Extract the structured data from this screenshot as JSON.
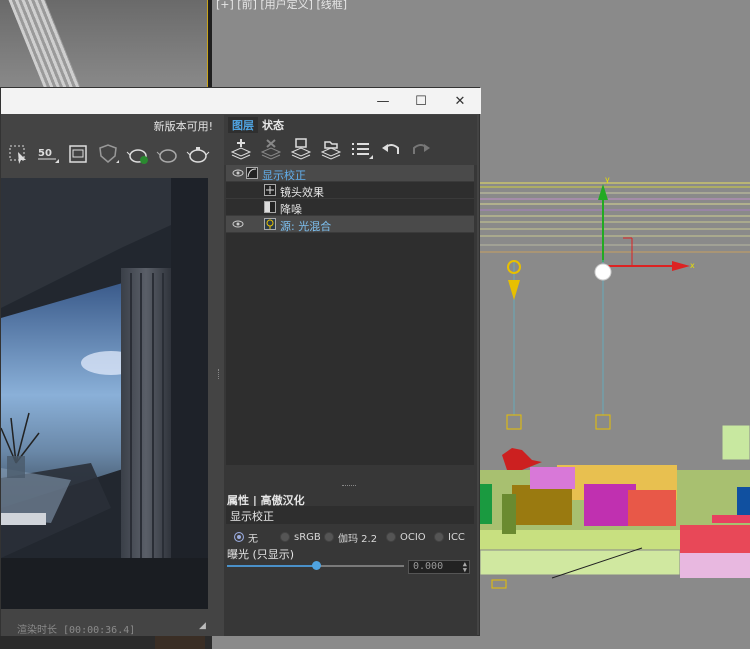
{
  "viewport_label": "[+] [前] [用户定义] [线框]",
  "window_controls": {
    "minimize": "—",
    "maximize": "☐",
    "close": "✕"
  },
  "update_notice": "新版本可用!",
  "toolbar_icons": [
    "region-select-icon",
    "zoom-50-icon",
    "frame-icon",
    "shield-icon",
    "teapot-render-icon",
    "teapot-dim-icon",
    "teapot-icon"
  ],
  "zoom_badge": "50",
  "status": {
    "render_time": "渲染时长 [00:00:36.4]"
  },
  "panel": {
    "tabs": {
      "layers": "图层",
      "state": "状态"
    },
    "tree": [
      {
        "label": "显示校正",
        "selected": true,
        "visible": true,
        "depth": 0
      },
      {
        "label": "镜头效果",
        "selected": false,
        "visible": false,
        "depth": 1
      },
      {
        "label": "降噪",
        "selected": false,
        "visible": false,
        "depth": 1
      },
      {
        "label": "源: 光混合",
        "selected": true,
        "visible": true,
        "depth": 0
      }
    ],
    "props_header": "属性 | 高傲汉化",
    "props_section": "显示校正",
    "radios": [
      {
        "label": "无",
        "checked": true
      },
      {
        "label": "sRGB",
        "checked": false
      },
      {
        "label": "伽玛 2.2",
        "checked": false
      },
      {
        "label": "OCIO",
        "checked": false
      },
      {
        "label": "ICC",
        "checked": false
      }
    ],
    "exposure_label": "曝光 (只显示)",
    "exposure_value": "0.000",
    "exposure_level": 0.5
  },
  "colors": {
    "accent": "#4fa3e0",
    "panel_bg": "#373737",
    "viewport_bg": "#8a8a8a"
  }
}
